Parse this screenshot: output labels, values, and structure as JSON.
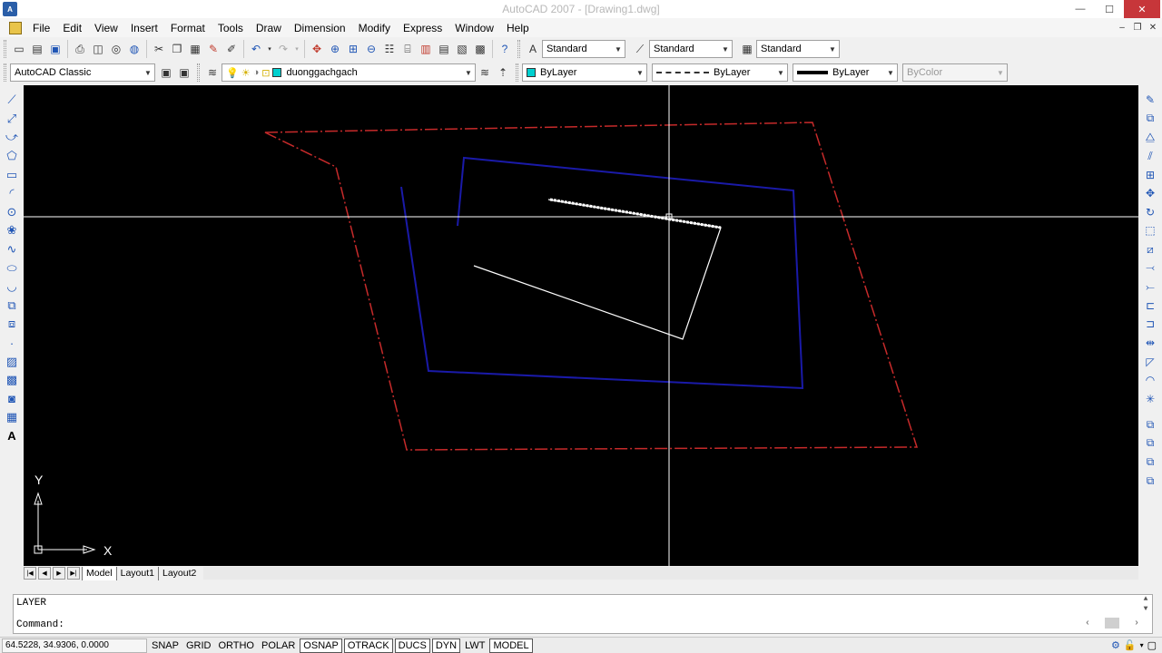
{
  "window": {
    "title": "AutoCAD 2007 - [Drawing1.dwg]",
    "app_icon_text": "A",
    "controls": {
      "minimize": "—",
      "maximize": "☐",
      "close": "✕"
    }
  },
  "menu": {
    "items": [
      "File",
      "Edit",
      "View",
      "Insert",
      "Format",
      "Tools",
      "Draw",
      "Dimension",
      "Modify",
      "Express",
      "Window",
      "Help"
    ],
    "doc_controls": {
      "minimize": "–",
      "restore": "❐",
      "close": "✕"
    }
  },
  "styles_toolbar": {
    "text_style": "Standard",
    "dim_style": "Standard",
    "table_style": "Standard"
  },
  "workspace_toolbar": {
    "workspace": "AutoCAD Classic",
    "layer": "duonggachgach",
    "color": "ByLayer",
    "linetype": "ByLayer",
    "lineweight": "ByLayer",
    "plot_style": "ByColor"
  },
  "colors": {
    "canvas_bg": "#000000",
    "outer_frame": "#c62a2a",
    "inner_frame": "#1a1aa8",
    "polyline": "#ffffff",
    "crosshair": "#ffffff",
    "layer_swatch": "#00d0d0"
  },
  "ucs": {
    "x_label": "X",
    "y_label": "Y"
  },
  "layout_tabs": [
    {
      "label": "Model",
      "active": true
    },
    {
      "label": "Layout1",
      "active": false
    },
    {
      "label": "Layout2",
      "active": false
    }
  ],
  "command_window": {
    "history": "LAYER",
    "prompt": "Command:"
  },
  "status": {
    "coordinates": "64.5228,  34.9306, 0.0000",
    "toggles": [
      {
        "label": "SNAP",
        "on": false
      },
      {
        "label": "GRID",
        "on": false
      },
      {
        "label": "ORTHO",
        "on": false
      },
      {
        "label": "POLAR",
        "on": false
      },
      {
        "label": "OSNAP",
        "on": true
      },
      {
        "label": "OTRACK",
        "on": true
      },
      {
        "label": "DUCS",
        "on": true
      },
      {
        "label": "DYN",
        "on": true
      },
      {
        "label": "LWT",
        "on": false
      },
      {
        "label": "MODEL",
        "on": true
      }
    ]
  }
}
